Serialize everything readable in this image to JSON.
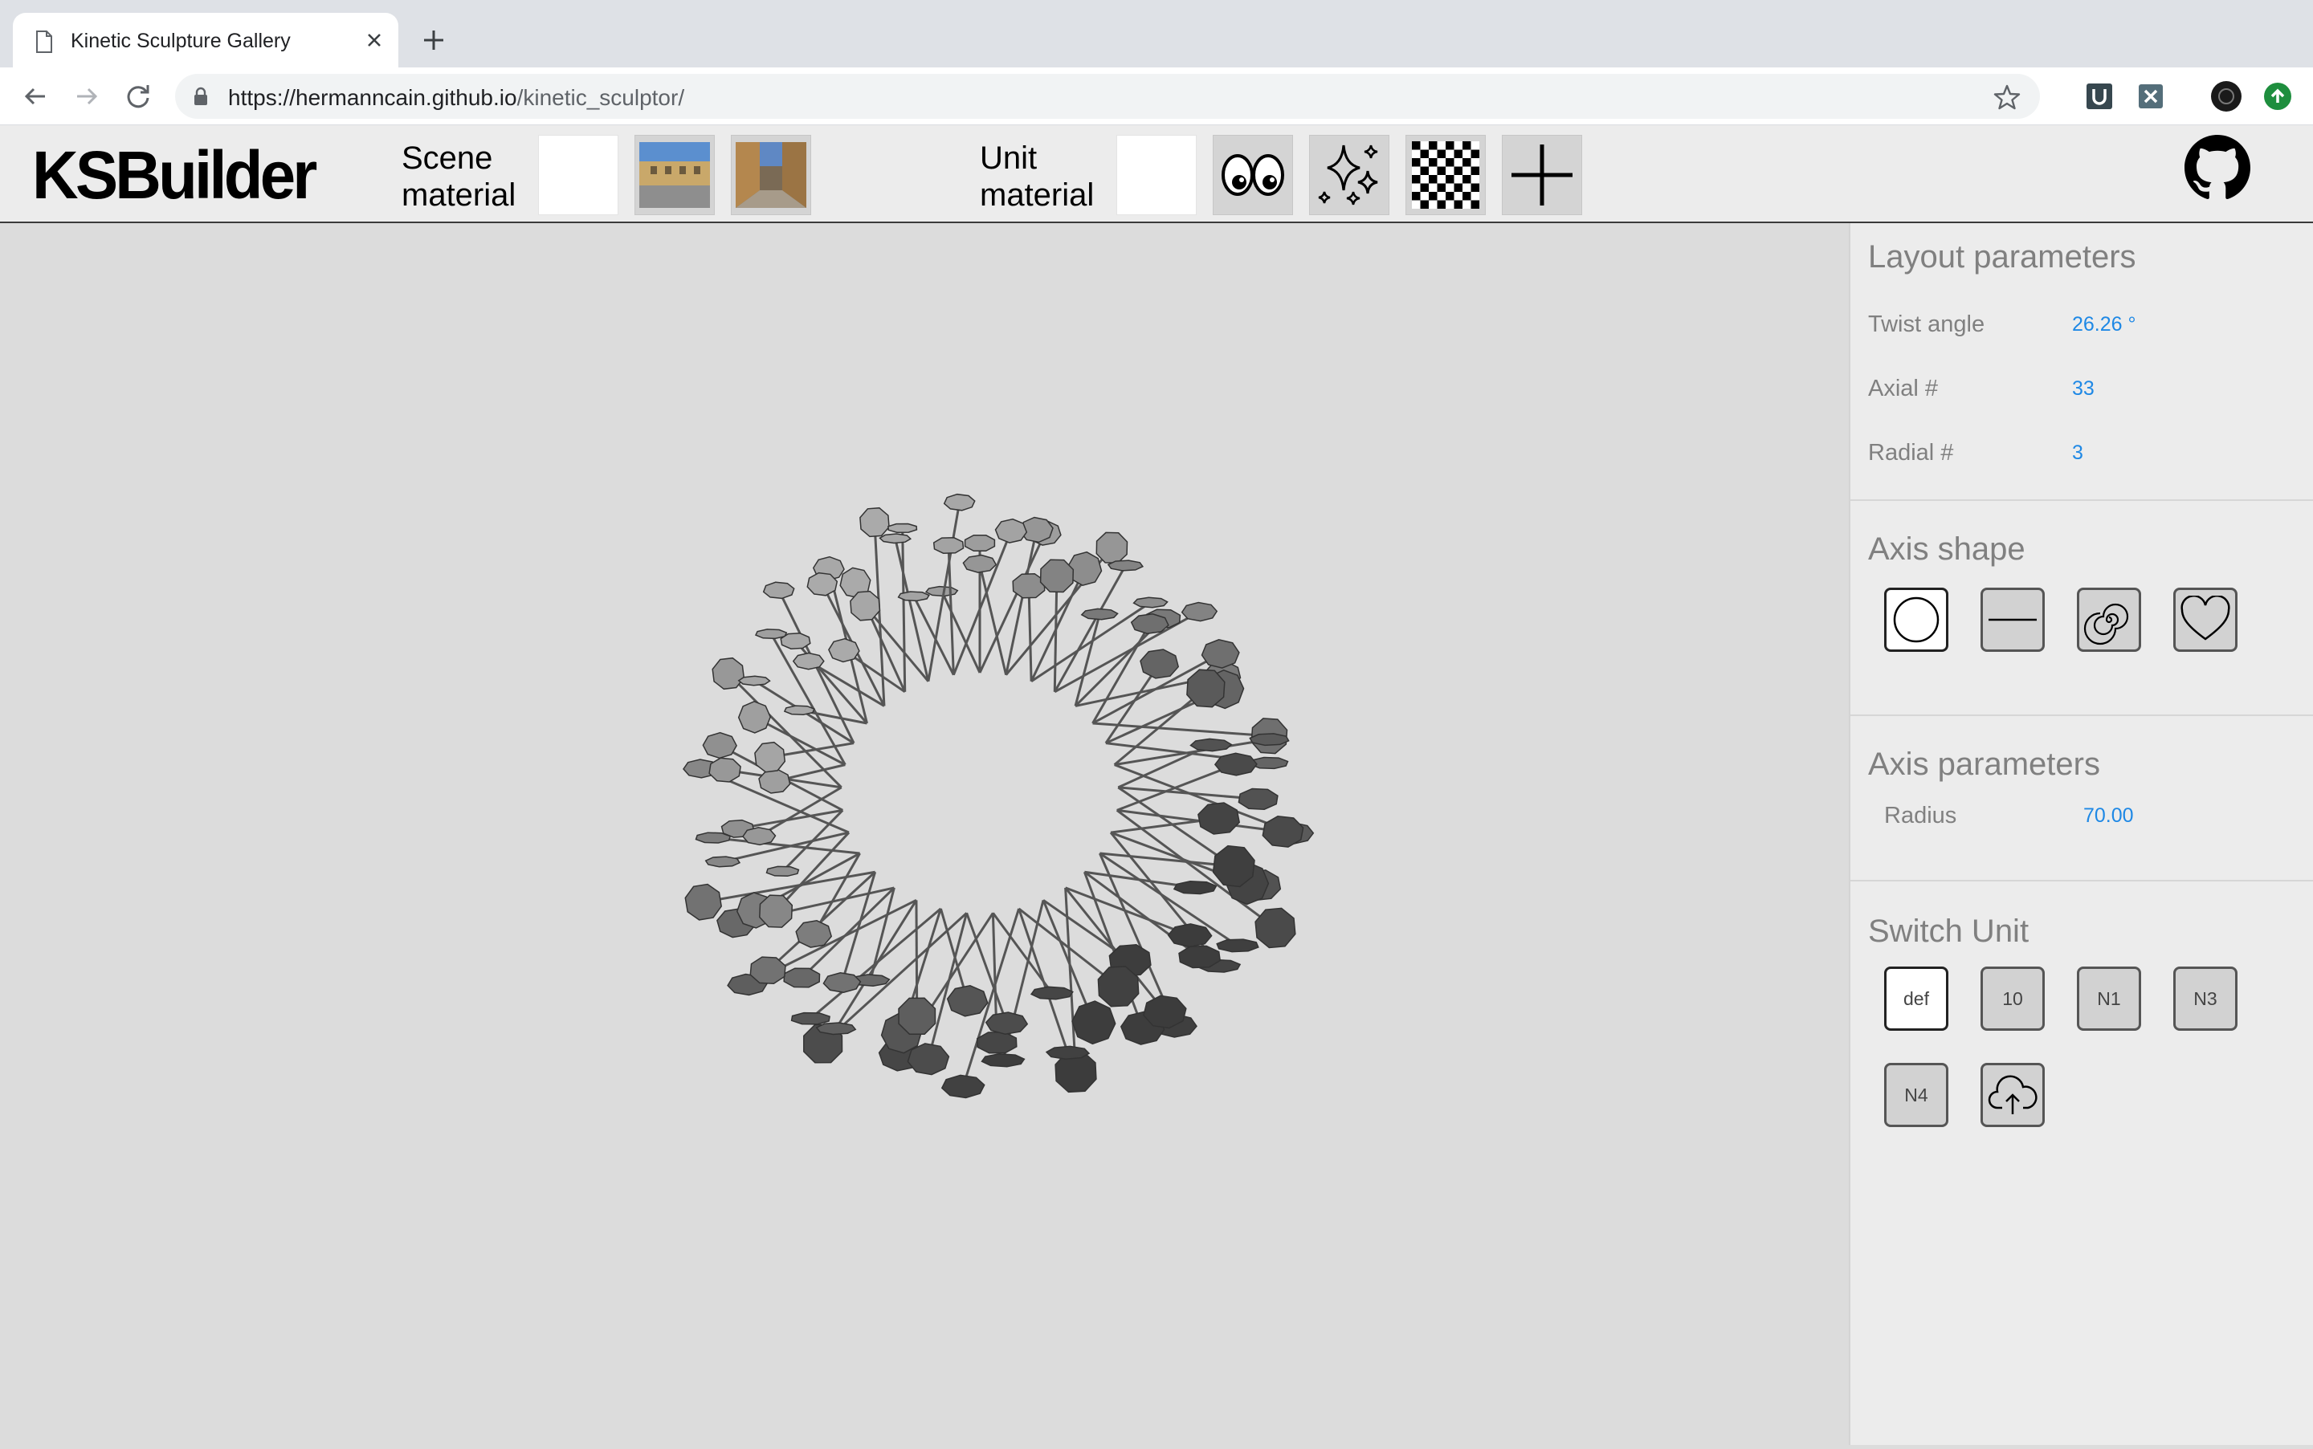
{
  "browser": {
    "tab_title": "Kinetic Sculpture Gallery",
    "url_host": "https://hermanncain.github.io",
    "url_path": "/kinetic_sculptor/"
  },
  "app": {
    "logo": "KSBuilder",
    "scene_material_label_1": "Scene",
    "scene_material_label_2": "material",
    "unit_material_label_1": "Unit",
    "unit_material_label_2": "material",
    "scene_materials": [
      "plain-white",
      "villa-photo",
      "street-photo"
    ],
    "unit_materials": [
      "plain-white",
      "eyes-icon",
      "sparkles-icon",
      "checker-icon",
      "plus-icon"
    ]
  },
  "panel": {
    "layout": {
      "title": "Layout parameters",
      "twist_label": "Twist angle",
      "twist_value": "26.26 °",
      "axial_label": "Axial #",
      "axial_value": "33",
      "radial_label": "Radial #",
      "radial_value": "3"
    },
    "axis_shape": {
      "title": "Axis shape",
      "shapes": [
        "circle",
        "line",
        "spiral",
        "heart"
      ],
      "selected": "circle"
    },
    "axis_params": {
      "title": "Axis parameters",
      "radius_label": "Radius",
      "radius_value": "70.00"
    },
    "switch_unit": {
      "title": "Switch Unit",
      "units": [
        "def",
        "10",
        "N1",
        "N3",
        "N4"
      ],
      "selected": "def"
    }
  },
  "colors": {
    "accent_value": "#1e88e5",
    "viewport_bg": "#dcdcdc",
    "panel_bg": "#ececec"
  }
}
